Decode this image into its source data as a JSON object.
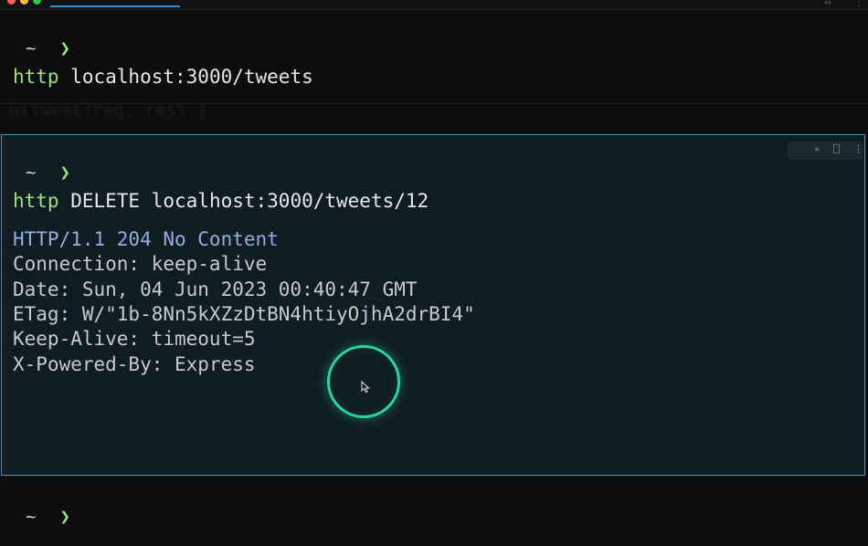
{
  "colors": {
    "background": "#0b0c0d",
    "selected_block_border": "#3f9cc3",
    "prompt_chevron": "#9be37a",
    "cursor_ring": "#2ed39b",
    "status_line": "#8fb0dc"
  },
  "icons": {
    "block_actions": [
      "pin-icon",
      "bookmark-icon",
      "more-icon"
    ],
    "cursor": "mouse-pointer-icon"
  },
  "blocks": [
    {
      "prompt": {
        "dir": "~",
        "chevron": "❯"
      },
      "command": {
        "program": "http",
        "args": " localhost:3000/tweets"
      }
    },
    {
      "prompt": {
        "dir": "~",
        "chevron": "❯"
      },
      "command": {
        "program": "http",
        "args": " DELETE localhost:3000/tweets/12"
      },
      "output": {
        "status": "HTTP/1.1 204 No Content",
        "headers": [
          "Connection: keep-alive",
          "Date: Sun, 04 Jun 2023 00:40:47 GMT",
          "ETag: W/\"1b-8Nn5kXZzDtBN4htiyOjhA2drBI4\"",
          "Keep-Alive: timeout=5",
          "X-Powered-By: Express"
        ]
      }
    }
  ],
  "current_prompt": {
    "dir": "~",
    "chevron": "❯"
  }
}
